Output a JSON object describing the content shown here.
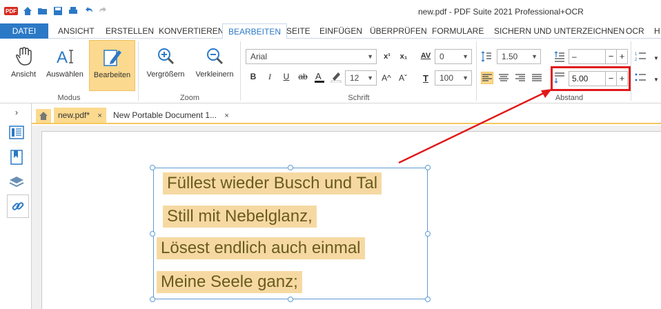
{
  "window": {
    "title": "new.pdf   -   PDF Suite 2021  Professional+OCR"
  },
  "quick_access": {
    "logo_text": "PDF"
  },
  "ribbon_tabs": [
    {
      "label": "DATEI"
    },
    {
      "label": "ANSICHT"
    },
    {
      "label": "ERSTELLEN"
    },
    {
      "label": "KONVERTIEREN"
    },
    {
      "label": "BEARBEITEN"
    },
    {
      "label": "SEITE"
    },
    {
      "label": "EINFÜGEN"
    },
    {
      "label": "ÜBERPRÜFEN"
    },
    {
      "label": "FORMULARE"
    },
    {
      "label": "SICHERN UND UNTERZEICHNEN"
    },
    {
      "label": "OCR"
    },
    {
      "label": "H"
    }
  ],
  "groups": {
    "modus": {
      "label": "Modus",
      "buttons": [
        "Ansicht",
        "Auswählen",
        "Bearbeiten"
      ]
    },
    "zoom": {
      "label": "Zoom",
      "buttons": [
        "Vergrößern",
        "Verkleinern"
      ]
    },
    "schrift": {
      "label": "Schrift",
      "font": "Arial",
      "size": "12",
      "char_spacing": "0",
      "scale": "100",
      "bold": "B",
      "italic": "I",
      "underline": "U",
      "strike": "ab",
      "superscript": "x¹",
      "subscript": "x₁",
      "grow": "A^",
      "shrink": "Aˇ",
      "av": "AV",
      "t": "T"
    },
    "abstand": {
      "label": "Abstand",
      "line_spacing": "1.50",
      "before": "–",
      "after": "5.00"
    }
  },
  "doc_tabs": [
    {
      "label": "new.pdf*",
      "close": "×"
    },
    {
      "label": "New Portable Document 1...",
      "close": "×"
    }
  ],
  "document": {
    "lines": [
      "Füllest wieder Busch und Tal",
      "Still mit Nebelglanz,",
      "Lösest endlich auch einmal",
      "Meine Seele ganz;"
    ]
  },
  "colors": {
    "accent": "#2b79c6",
    "selected": "#fbd98f",
    "highlight_box": "#e0191b",
    "arrow": "#e0191b",
    "text_bg": "#f6d9a2"
  }
}
